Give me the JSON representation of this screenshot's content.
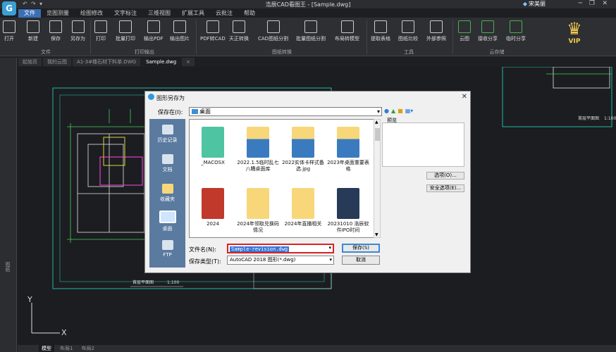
{
  "app": {
    "title": "浩辰CAD看图王 - [Sample.dwg]",
    "logo": "G",
    "user": "宋美丽",
    "user_icon": "diamond-icon"
  },
  "menu": [
    "文件",
    "览图测量",
    "绘图修改",
    "文字标注",
    "三维视图",
    "扩展工具",
    "云批注",
    "帮助"
  ],
  "ribbon": {
    "buttons": [
      "打开",
      "新建",
      "保存",
      "另存为",
      "打印",
      "批量打印",
      "输出PDF",
      "输出图片",
      "PDF转CAD",
      "天正转换",
      "CAD图纸分割",
      "批量图纸分割",
      "布局转模型",
      "提取表格",
      "图纸比较",
      "外部参照",
      "云图",
      "接收分享",
      "临时分享"
    ],
    "groups": [
      "文件",
      "打印输出",
      "图纸转换",
      "工具",
      "云存储"
    ]
  },
  "vip": {
    "label": "VIP"
  },
  "tabs": [
    "起始页",
    "我的云图",
    "A1-3#楼石材下料单.DWG",
    "Sample.dwg"
  ],
  "side_label": "图纸",
  "bottom_tabs": [
    "模型",
    "布局1",
    "布局2"
  ],
  "dialog": {
    "title": "图形另存为",
    "save_in_label": "保存在(I):",
    "save_in_value": "桌面",
    "preview_label": "预览",
    "places": [
      "历史记录",
      "文档",
      "收藏夹",
      "桌面",
      "FTP"
    ],
    "files": [
      {
        "name": "_MACOSX",
        "kind": "img"
      },
      {
        "name": "2022.1.5临时乱七八糟桌面库",
        "kind": "doc"
      },
      {
        "name": "2022实体卡样式备选.jpg",
        "kind": "doc"
      },
      {
        "name": "2023年桌面重要表格",
        "kind": "doc"
      },
      {
        "name": "2024",
        "kind": "red"
      },
      {
        "name": "2024年领取兑换码情况",
        "kind": "folder"
      },
      {
        "name": "2024年直播相关",
        "kind": "folder"
      },
      {
        "name": "20231010 浩辰软件IPO时间",
        "kind": "dark"
      }
    ],
    "options_label": "选项(O)...",
    "security_label": "安全选项(E)...",
    "filename_label": "文件名(N):",
    "filename_value": "Sample-revision.dwg",
    "filetype_label": "保存类型(T):",
    "filetype_value": "AutoCAD 2018 图形(*.dwg)",
    "save_label": "保存(S)",
    "cancel_label": "取消"
  },
  "drawing": {
    "label1": "首层平面图",
    "scale": "1:100",
    "axis_y": "Y",
    "axis_x": "X"
  }
}
